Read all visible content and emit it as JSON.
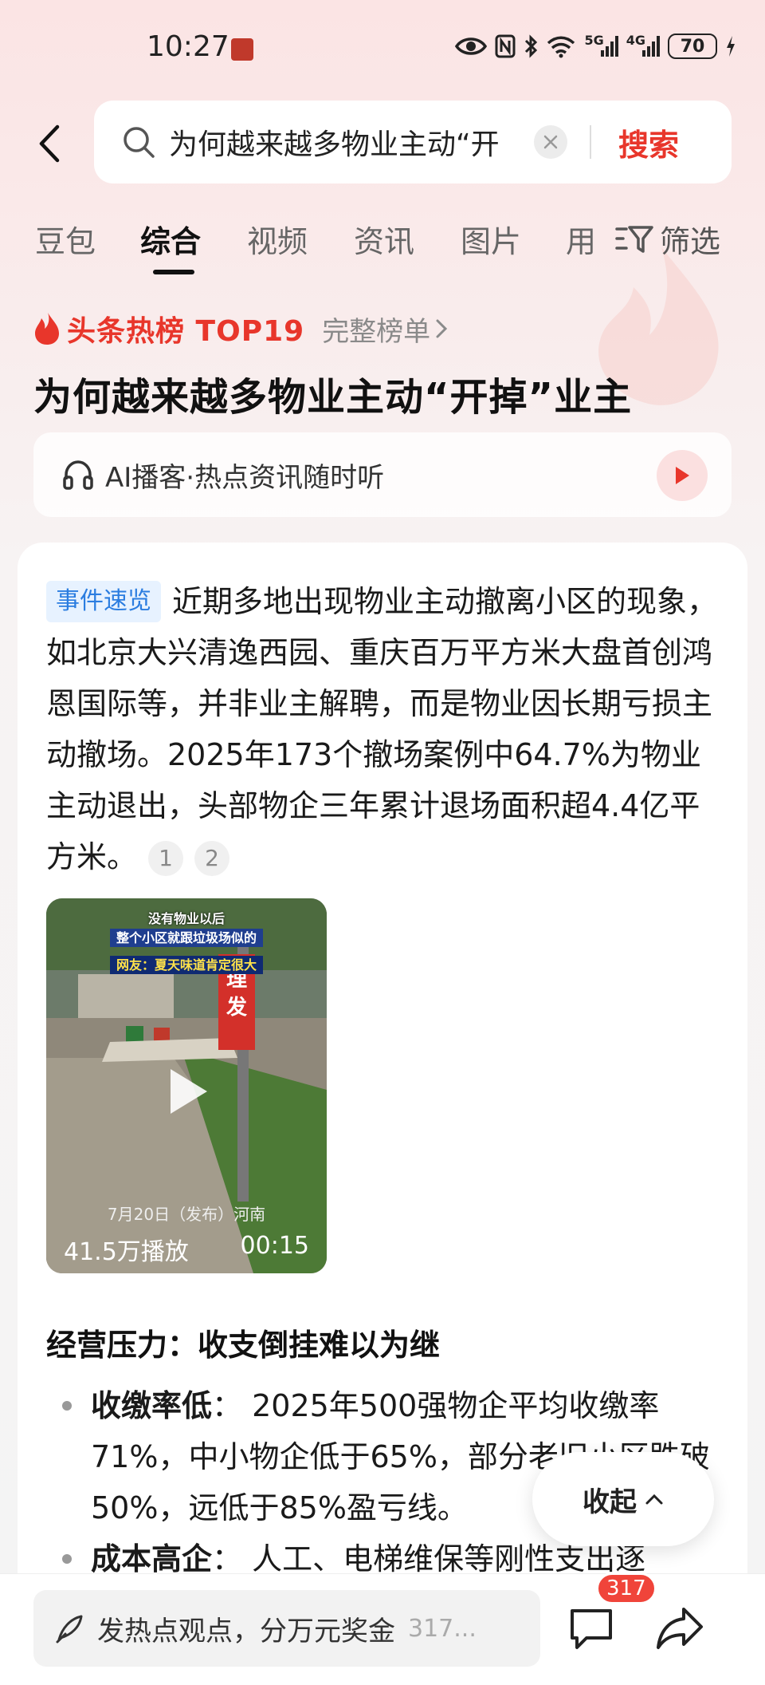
{
  "status_bar": {
    "time": "10:27",
    "battery": "70",
    "net1": "5G",
    "net2": "4G"
  },
  "search": {
    "back_icon": "chevron-left-icon",
    "query": "为何越来越多物业主动“开",
    "clear_icon": "close-icon",
    "button": "搜索"
  },
  "tabs": [
    {
      "label": "豆包"
    },
    {
      "label": "综合",
      "active": true
    },
    {
      "label": "视频"
    },
    {
      "label": "资讯"
    },
    {
      "label": "图片"
    },
    {
      "label": "用"
    }
  ],
  "filter_label": "筛选",
  "hot": {
    "rank": "头条热榜 TOP19",
    "full_list": "完整榜单",
    "headline": "为何越来越多物业主动“开掉”业主"
  },
  "ai_podcast": {
    "label": "AI播客·热点资讯随时听"
  },
  "summary": {
    "tag": "事件速览",
    "text": "近期多地出现物业主动撤离小区的现象，如北京大兴清逸西园、重庆百万平方米大盘首创鸿恩国际等，并非业主解聘，而是物业因长期亏损主动撤场。2025年173个撤场案例中64.7%为物业主动退出，头部物企三年累计退场面积超4.4亿平方米。",
    "refs": [
      "1",
      "2"
    ]
  },
  "video": {
    "caption1": "没有物业以后",
    "caption2": "整个小区就跟垃圾场似的",
    "caption3": "网友：夏天味道肯定很大",
    "sign_text": "理发",
    "date_location": "7月20日（发布）河南",
    "views": "41.5万播放",
    "duration": "00:15"
  },
  "section": {
    "title": "经营压力：收支倒挂难以为继",
    "bullets": [
      {
        "bold": "收缴率低",
        "text": "： 2025年500强物企平均收缴率71%，中小物企低于65%，部分老旧小区跌破50%，远低于85%盈亏线。"
      },
      {
        "bold": "成本高企",
        "text": "： 人工、电梯维保等刚性支出逐"
      }
    ]
  },
  "collapse": {
    "label": "收起"
  },
  "bottom_bar": {
    "comment_placeholder": "发热点观点，分万元奖金",
    "comment_count": "317...",
    "message_badge": "317"
  }
}
